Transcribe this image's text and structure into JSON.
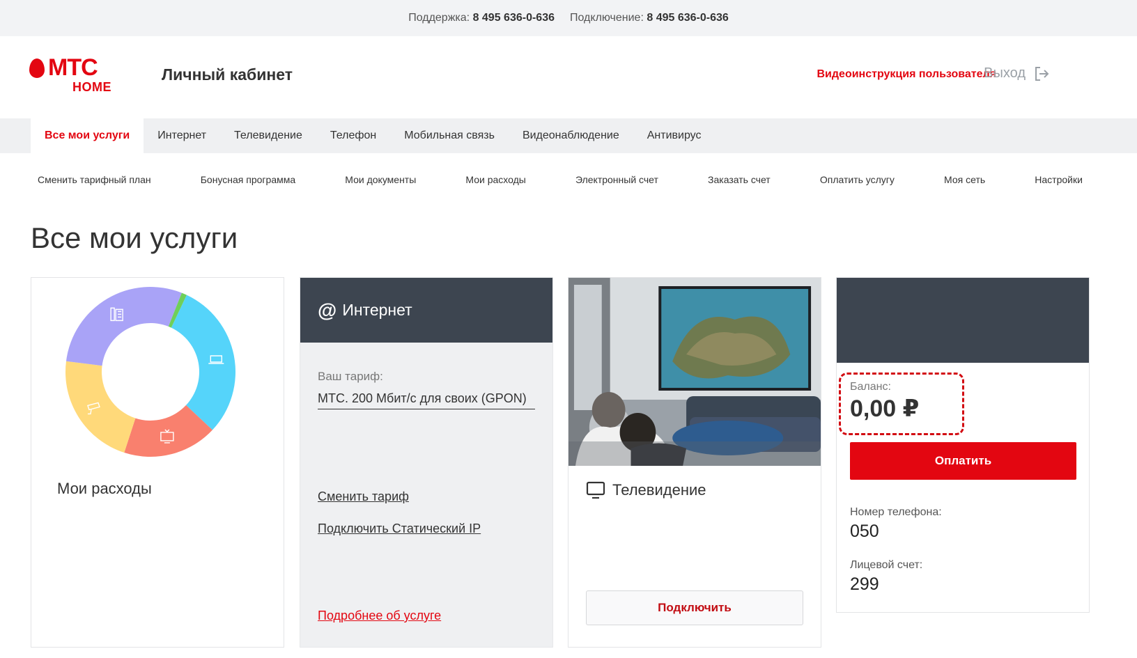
{
  "topbar": {
    "support_label": "Поддержка:",
    "support_phone": "8 495 636-0-636",
    "connect_label": "Подключение:",
    "connect_phone": "8 495 636-0-636"
  },
  "header": {
    "logo_main": "МТС",
    "logo_sub": "HOME",
    "title": "Личный кабинет",
    "video_link": "Видеоинструкция пользователя",
    "logout": "Выход"
  },
  "tabs": [
    {
      "label": "Все мои услуги",
      "active": true
    },
    {
      "label": "Интернет"
    },
    {
      "label": "Телевидение"
    },
    {
      "label": "Телефон"
    },
    {
      "label": "Мобильная связь"
    },
    {
      "label": "Видеонаблюдение"
    },
    {
      "label": "Антивирус"
    }
  ],
  "subnav": [
    "Сменить тарифный план",
    "Бонусная программа",
    "Мои документы",
    "Мои расходы",
    "Электронный счет",
    "Заказать счет",
    "Оплатить услугу",
    "Моя сеть",
    "Настройки"
  ],
  "page_title": "Все мои услуги",
  "expenses_card": {
    "label": "Мои расходы",
    "segments": [
      {
        "icon": "laptop-icon",
        "color": "#55d4fa",
        "fraction": 0.3
      },
      {
        "icon": "tv-icon",
        "color": "#f9806e",
        "fraction": 0.18
      },
      {
        "icon": "camera-icon",
        "color": "#ffd97a",
        "fraction": 0.22
      },
      {
        "icon": "phone-icon",
        "color": "#a9a3f7",
        "fraction": 0.29
      },
      {
        "icon": "",
        "color": "#6fcf5a",
        "fraction": 0.01
      }
    ]
  },
  "internet_card": {
    "at": "@",
    "title": "Интернет",
    "tariff_label": "Ваш тариф:",
    "tariff_value": "МТС. 200 Мбит/с для своих (GPON)",
    "change_tariff": "Сменить тариф",
    "static_ip": "Подключить Статический IP",
    "more": "Подробнее об услуге"
  },
  "tv_card": {
    "title": "Телевидение",
    "connect": "Подключить"
  },
  "account_card": {
    "balance_label": "Баланс:",
    "balance_value": "0,00 ₽",
    "pay": "Оплатить",
    "phone_label": "Номер телефона:",
    "phone_value": "050",
    "account_label": "Лицевой счет:",
    "account_value": "299"
  },
  "colors": {
    "brand_red": "#e30611",
    "dark_header": "#3d4550",
    "tab_bg": "#eff0f2"
  }
}
